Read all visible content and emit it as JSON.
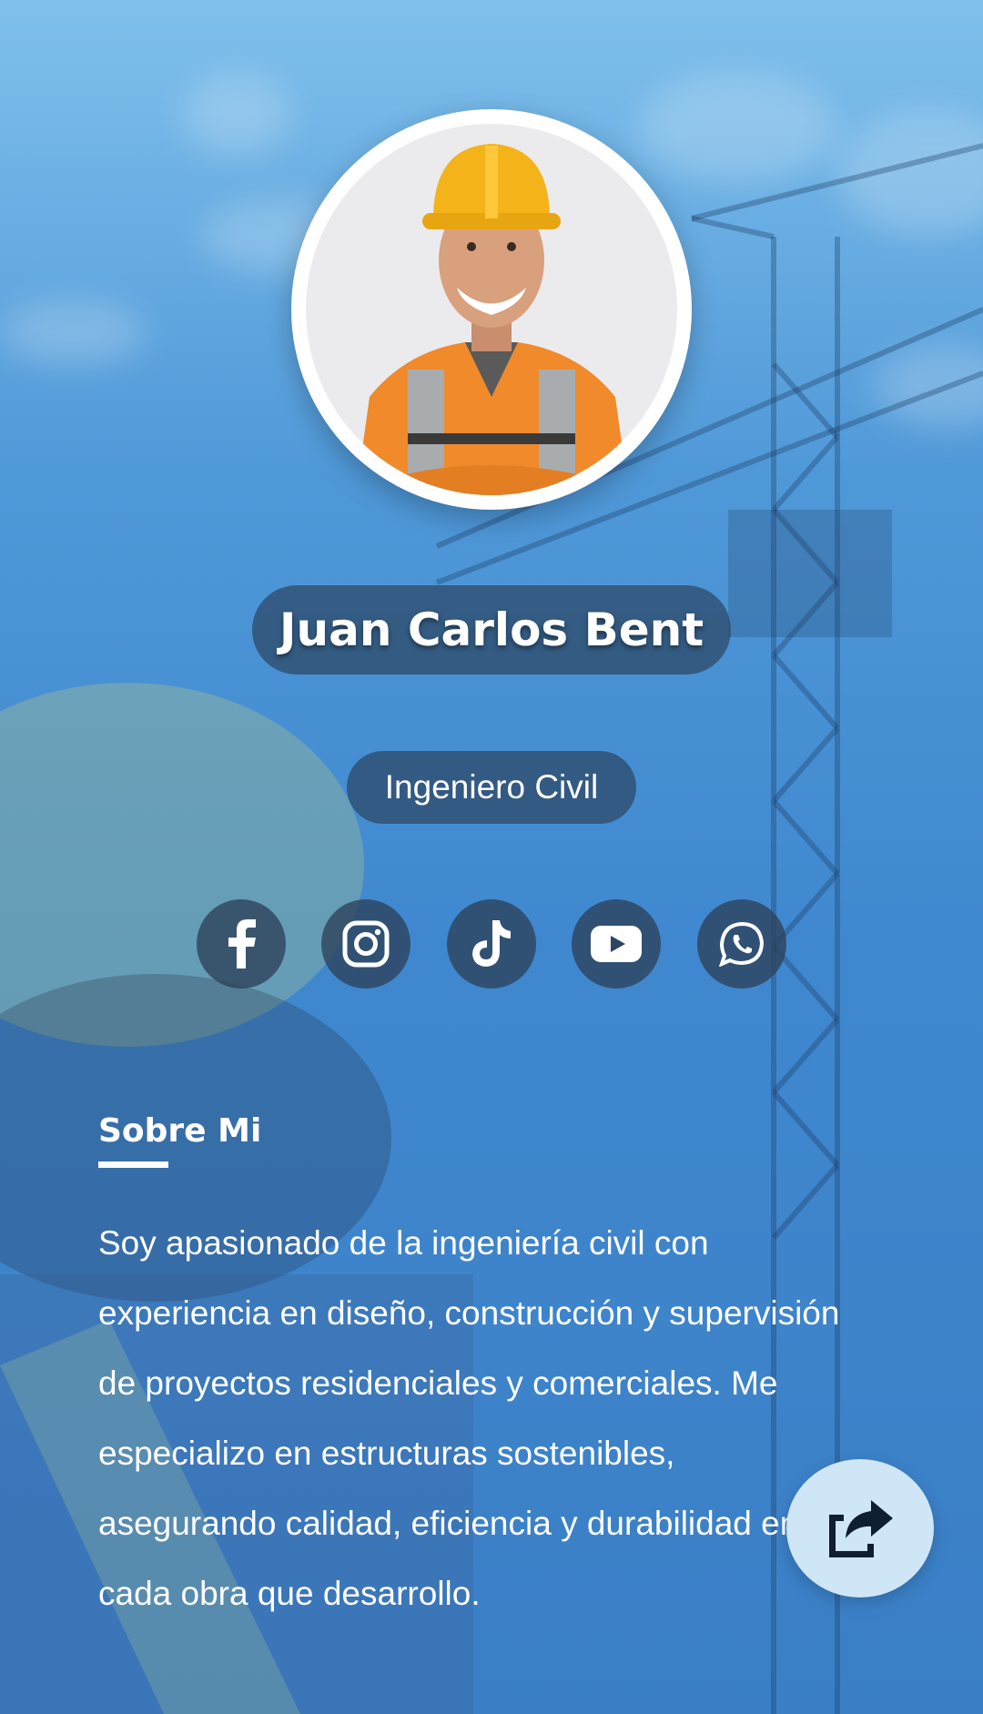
{
  "profile": {
    "name": "Juan Carlos Bent",
    "title": "Ingeniero Civil",
    "avatar_alt": "profile-photo"
  },
  "social": [
    {
      "name": "facebook",
      "icon": "facebook-icon"
    },
    {
      "name": "instagram",
      "icon": "instagram-icon"
    },
    {
      "name": "tiktok",
      "icon": "tiktok-icon"
    },
    {
      "name": "youtube",
      "icon": "youtube-icon"
    },
    {
      "name": "whatsapp",
      "icon": "whatsapp-icon"
    }
  ],
  "about": {
    "heading": "Sobre Mi",
    "body": "Soy apasionado de la ingeniería civil con experiencia en diseño, construcción y supervisión de proyectos residenciales y comerciales. Me especializo en estructuras sostenibles, asegurando calidad, eficiencia y durabilidad en cada obra que desarrollo."
  },
  "share": {
    "icon": "share-icon"
  },
  "colors": {
    "background": "#4f98d8",
    "pill": "#2d4664",
    "fab": "#cfe6f7",
    "icon_dark": "#0f1e30"
  }
}
